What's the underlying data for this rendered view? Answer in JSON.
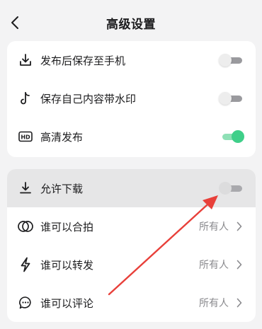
{
  "header": {
    "title": "高级设置"
  },
  "section1": {
    "items": [
      {
        "label": "发布后保存至手机",
        "icon": "download-icon",
        "toggle": "off"
      },
      {
        "label": "保存自己内容带水印",
        "icon": "tiktok-note-icon",
        "toggle": "off"
      },
      {
        "label": "高清发布",
        "icon": "hd-icon",
        "toggle": "on"
      }
    ]
  },
  "section2": {
    "items": [
      {
        "label": "允许下载",
        "icon": "download-icon",
        "toggle": "off",
        "highlighted": true
      },
      {
        "label": "谁可以合拍",
        "icon": "duet-icon",
        "value": "所有人"
      },
      {
        "label": "谁可以转发",
        "icon": "lightning-icon",
        "value": "所有人"
      },
      {
        "label": "谁可以评论",
        "icon": "comment-icon",
        "value": "所有人"
      }
    ]
  },
  "colors": {
    "background": "#f3f3f4",
    "card": "#ffffff",
    "toggle_on": "#3fcf89",
    "annotation_arrow": "#e8403a"
  }
}
